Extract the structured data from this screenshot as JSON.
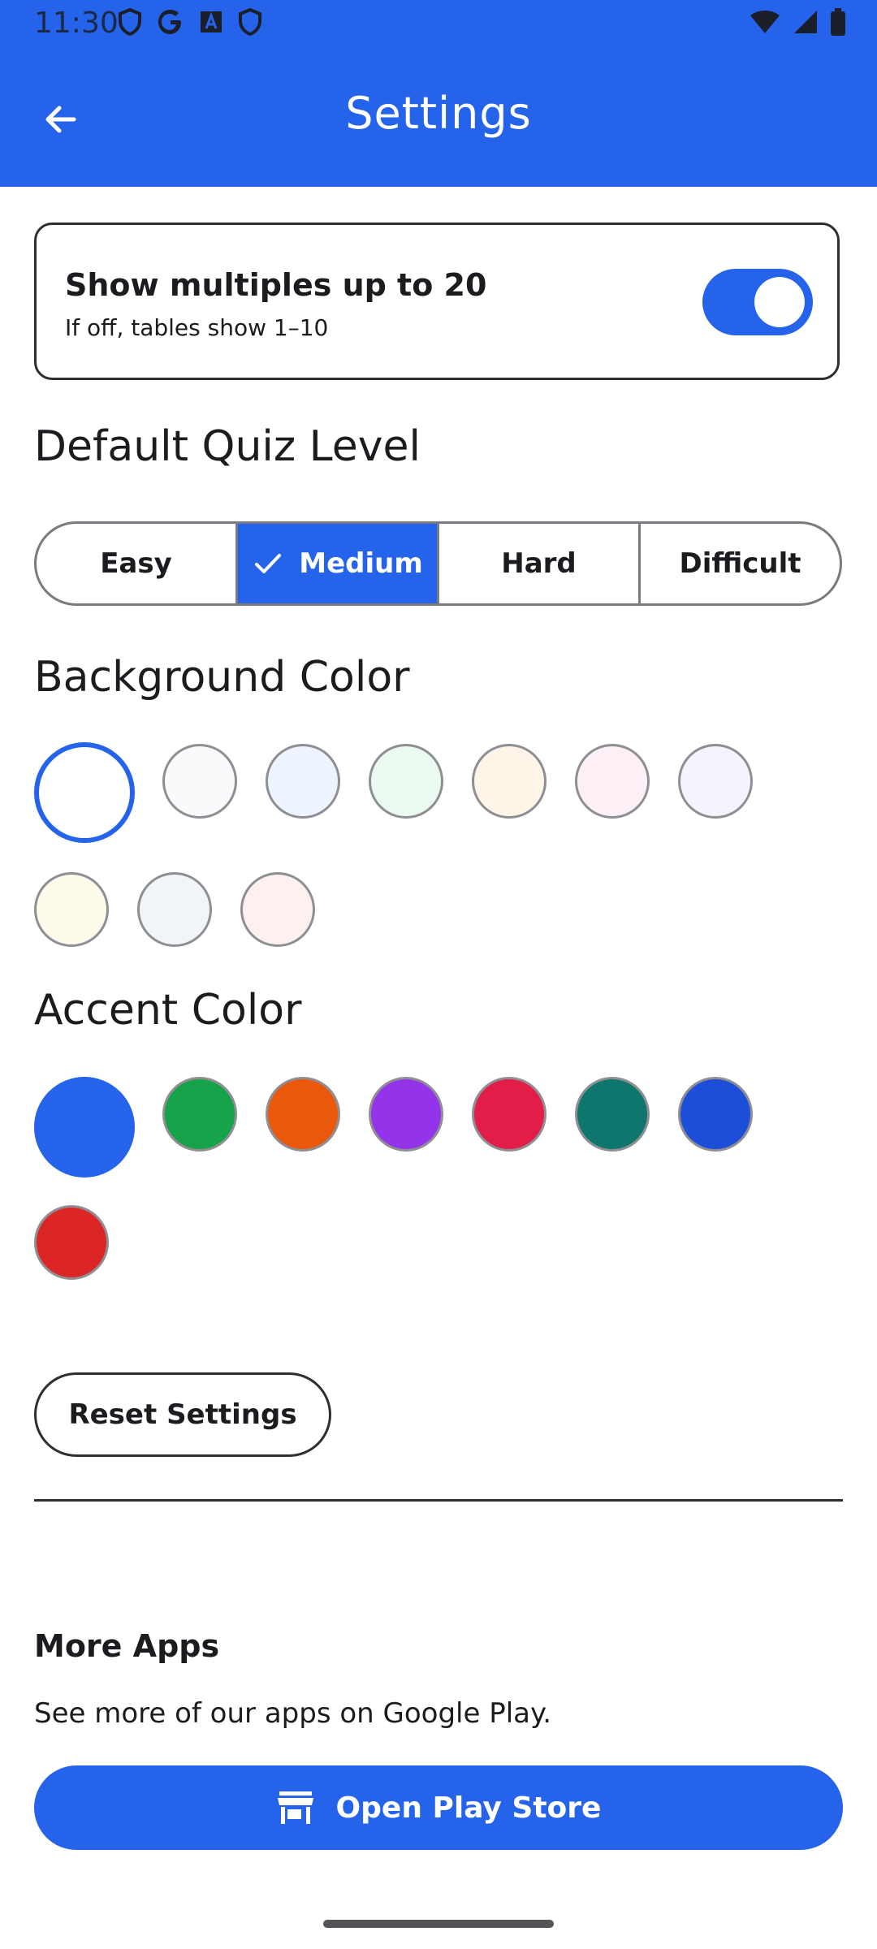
{
  "status_bar": {
    "time": "11:30",
    "left_icons": [
      "shield-icon",
      "google-icon",
      "font-a-icon",
      "shield-icon"
    ],
    "right_icons": [
      "wifi-icon",
      "signal-icon",
      "battery-icon"
    ]
  },
  "app_bar": {
    "title": "Settings",
    "back_icon": "arrow-back-icon",
    "color": "#2563eb"
  },
  "multiples_card": {
    "title": "Show multiples up to 20",
    "subtitle": "If off, tables show 1–10",
    "switch_on": true
  },
  "quiz_level": {
    "heading": "Default Quiz Level",
    "options": [
      "Easy",
      "Medium",
      "Hard",
      "Difficult"
    ],
    "selected": "Medium"
  },
  "background_color": {
    "heading": "Background Color",
    "colors": [
      "#ffffff",
      "#f8fafc",
      "#eef4ff",
      "#eafaf1",
      "#fff4e8",
      "#fcf0f6",
      "#f7f3fe",
      "#fffbea",
      "#f1f5f9",
      "#fff0f0"
    ],
    "selected_index": 0
  },
  "accent_color": {
    "heading": "Accent Color",
    "colors": [
      "#2563eb",
      "#16a34a",
      "#ea580c",
      "#9333ea",
      "#e11d48",
      "#0f766e",
      "#1d4ed8",
      "#dc2626"
    ],
    "selected_index": 0
  },
  "reset": {
    "label": "Reset Settings"
  },
  "more_apps": {
    "title": "More Apps",
    "description": "See more of our apps on Google Play.",
    "button_label": "Open Play Store",
    "button_icon": "store-icon"
  }
}
